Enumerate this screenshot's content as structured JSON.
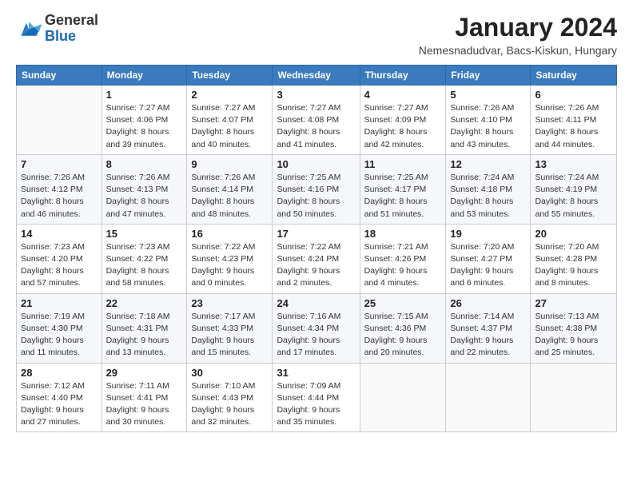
{
  "logo": {
    "general": "General",
    "blue": "Blue"
  },
  "title": "January 2024",
  "location": "Nemesnadudvar, Bacs-Kiskun, Hungary",
  "weekdays": [
    "Sunday",
    "Monday",
    "Tuesday",
    "Wednesday",
    "Thursday",
    "Friday",
    "Saturday"
  ],
  "weeks": [
    [
      {
        "day": "",
        "info": ""
      },
      {
        "day": "1",
        "info": "Sunrise: 7:27 AM\nSunset: 4:06 PM\nDaylight: 8 hours\nand 39 minutes."
      },
      {
        "day": "2",
        "info": "Sunrise: 7:27 AM\nSunset: 4:07 PM\nDaylight: 8 hours\nand 40 minutes."
      },
      {
        "day": "3",
        "info": "Sunrise: 7:27 AM\nSunset: 4:08 PM\nDaylight: 8 hours\nand 41 minutes."
      },
      {
        "day": "4",
        "info": "Sunrise: 7:27 AM\nSunset: 4:09 PM\nDaylight: 8 hours\nand 42 minutes."
      },
      {
        "day": "5",
        "info": "Sunrise: 7:26 AM\nSunset: 4:10 PM\nDaylight: 8 hours\nand 43 minutes."
      },
      {
        "day": "6",
        "info": "Sunrise: 7:26 AM\nSunset: 4:11 PM\nDaylight: 8 hours\nand 44 minutes."
      }
    ],
    [
      {
        "day": "7",
        "info": "Sunrise: 7:26 AM\nSunset: 4:12 PM\nDaylight: 8 hours\nand 46 minutes."
      },
      {
        "day": "8",
        "info": "Sunrise: 7:26 AM\nSunset: 4:13 PM\nDaylight: 8 hours\nand 47 minutes."
      },
      {
        "day": "9",
        "info": "Sunrise: 7:26 AM\nSunset: 4:14 PM\nDaylight: 8 hours\nand 48 minutes."
      },
      {
        "day": "10",
        "info": "Sunrise: 7:25 AM\nSunset: 4:16 PM\nDaylight: 8 hours\nand 50 minutes."
      },
      {
        "day": "11",
        "info": "Sunrise: 7:25 AM\nSunset: 4:17 PM\nDaylight: 8 hours\nand 51 minutes."
      },
      {
        "day": "12",
        "info": "Sunrise: 7:24 AM\nSunset: 4:18 PM\nDaylight: 8 hours\nand 53 minutes."
      },
      {
        "day": "13",
        "info": "Sunrise: 7:24 AM\nSunset: 4:19 PM\nDaylight: 8 hours\nand 55 minutes."
      }
    ],
    [
      {
        "day": "14",
        "info": "Sunrise: 7:23 AM\nSunset: 4:20 PM\nDaylight: 8 hours\nand 57 minutes."
      },
      {
        "day": "15",
        "info": "Sunrise: 7:23 AM\nSunset: 4:22 PM\nDaylight: 8 hours\nand 58 minutes."
      },
      {
        "day": "16",
        "info": "Sunrise: 7:22 AM\nSunset: 4:23 PM\nDaylight: 9 hours\nand 0 minutes."
      },
      {
        "day": "17",
        "info": "Sunrise: 7:22 AM\nSunset: 4:24 PM\nDaylight: 9 hours\nand 2 minutes."
      },
      {
        "day": "18",
        "info": "Sunrise: 7:21 AM\nSunset: 4:26 PM\nDaylight: 9 hours\nand 4 minutes."
      },
      {
        "day": "19",
        "info": "Sunrise: 7:20 AM\nSunset: 4:27 PM\nDaylight: 9 hours\nand 6 minutes."
      },
      {
        "day": "20",
        "info": "Sunrise: 7:20 AM\nSunset: 4:28 PM\nDaylight: 9 hours\nand 8 minutes."
      }
    ],
    [
      {
        "day": "21",
        "info": "Sunrise: 7:19 AM\nSunset: 4:30 PM\nDaylight: 9 hours\nand 11 minutes."
      },
      {
        "day": "22",
        "info": "Sunrise: 7:18 AM\nSunset: 4:31 PM\nDaylight: 9 hours\nand 13 minutes."
      },
      {
        "day": "23",
        "info": "Sunrise: 7:17 AM\nSunset: 4:33 PM\nDaylight: 9 hours\nand 15 minutes."
      },
      {
        "day": "24",
        "info": "Sunrise: 7:16 AM\nSunset: 4:34 PM\nDaylight: 9 hours\nand 17 minutes."
      },
      {
        "day": "25",
        "info": "Sunrise: 7:15 AM\nSunset: 4:36 PM\nDaylight: 9 hours\nand 20 minutes."
      },
      {
        "day": "26",
        "info": "Sunrise: 7:14 AM\nSunset: 4:37 PM\nDaylight: 9 hours\nand 22 minutes."
      },
      {
        "day": "27",
        "info": "Sunrise: 7:13 AM\nSunset: 4:38 PM\nDaylight: 9 hours\nand 25 minutes."
      }
    ],
    [
      {
        "day": "28",
        "info": "Sunrise: 7:12 AM\nSunset: 4:40 PM\nDaylight: 9 hours\nand 27 minutes."
      },
      {
        "day": "29",
        "info": "Sunrise: 7:11 AM\nSunset: 4:41 PM\nDaylight: 9 hours\nand 30 minutes."
      },
      {
        "day": "30",
        "info": "Sunrise: 7:10 AM\nSunset: 4:43 PM\nDaylight: 9 hours\nand 32 minutes."
      },
      {
        "day": "31",
        "info": "Sunrise: 7:09 AM\nSunset: 4:44 PM\nDaylight: 9 hours\nand 35 minutes."
      },
      {
        "day": "",
        "info": ""
      },
      {
        "day": "",
        "info": ""
      },
      {
        "day": "",
        "info": ""
      }
    ]
  ]
}
